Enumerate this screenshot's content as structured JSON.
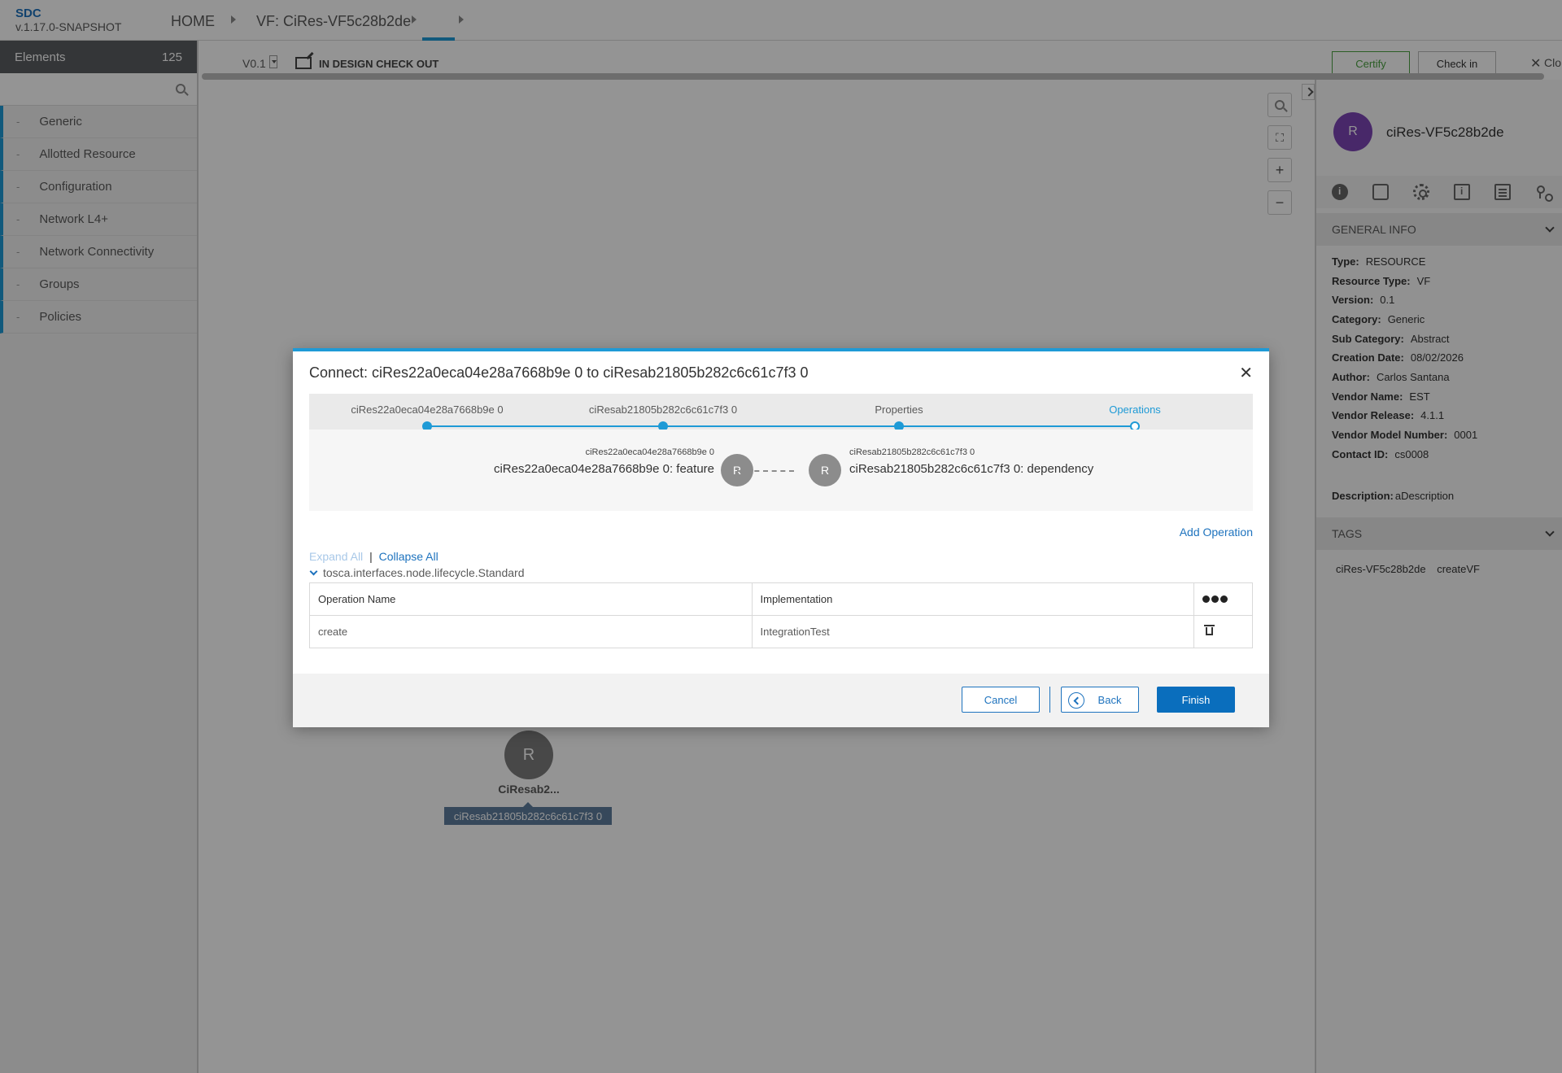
{
  "app": {
    "name": "SDC",
    "version": "v.1.17.0-SNAPSHOT"
  },
  "breadcrumb": {
    "home": "HOME",
    "current": "VF: CiRes-VF5c28b2de"
  },
  "sidebar": {
    "title": "Elements",
    "count": "125",
    "search_placeholder": "",
    "items": [
      {
        "label": "Generic"
      },
      {
        "label": "Allotted Resource"
      },
      {
        "label": "Configuration"
      },
      {
        "label": "Network L4+"
      },
      {
        "label": "Network Connectivity"
      },
      {
        "label": "Groups"
      },
      {
        "label": "Policies"
      }
    ]
  },
  "toolbar": {
    "version": "V0.1",
    "status": "IN DESIGN CHECK OUT",
    "certify": "Certify",
    "checkin": "Check in",
    "close": "Clo"
  },
  "canvas": {
    "node_letter": "R",
    "node_label": "CiResab2...",
    "node_tooltip": "ciResab21805b282c6c61c7f3 0"
  },
  "right_panel": {
    "avatar_letter": "R",
    "name": "ciRes-VF5c28b2de",
    "general_info_title": "GENERAL INFO",
    "info": [
      {
        "label": "Type:",
        "value": "RESOURCE"
      },
      {
        "label": "Resource Type:",
        "value": "VF"
      },
      {
        "label": "Version:",
        "value": "0.1"
      },
      {
        "label": "Category:",
        "value": "Generic"
      },
      {
        "label": "Sub Category:",
        "value": "Abstract"
      },
      {
        "label": "Creation Date:",
        "value": "08/02/2026"
      },
      {
        "label": "Author:",
        "value": "Carlos Santana"
      },
      {
        "label": "Vendor Name:",
        "value": "EST"
      },
      {
        "label": "Vendor Release:",
        "value": "4.1.1"
      },
      {
        "label": "Vendor Model Number:",
        "value": "0001"
      },
      {
        "label": "Contact ID:",
        "value": "cs0008"
      }
    ],
    "description_label": "Description:",
    "description_value": "aDescription",
    "tags_title": "TAGS",
    "tags": [
      "ciRes-VF5c28b2de",
      "createVF"
    ]
  },
  "modal": {
    "title": "Connect: ciRes22a0eca04e28a7668b9e 0 to ciResab21805b282c6c61c7f3 0",
    "steps": [
      {
        "label": "ciRes22a0eca04e28a7668b9e 0"
      },
      {
        "label": "ciResab21805b282c6c61c7f3 0"
      },
      {
        "label": "Properties"
      },
      {
        "label": "Operations"
      }
    ],
    "source": {
      "name": "ciRes22a0eca04e28a7668b9e 0",
      "requirement": "ciRes22a0eca04e28a7668b9e 0: feature",
      "letter": "R"
    },
    "target": {
      "name": "ciResab21805b282c6c61c7f3 0",
      "capability": "ciResab21805b282c6c61c7f3 0: dependency",
      "letter": "R"
    },
    "add_operation": "Add Operation",
    "expand_all": "Expand All",
    "separator": "|",
    "collapse_all": "Collapse All",
    "interface": "tosca.interfaces.node.lifecycle.Standard",
    "table": {
      "col_operation": "Operation Name",
      "col_implementation": "Implementation",
      "rows": [
        {
          "operation": "create",
          "implementation": "IntegrationTest"
        }
      ]
    },
    "buttons": {
      "cancel": "Cancel",
      "back": "Back",
      "finish": "Finish"
    }
  }
}
